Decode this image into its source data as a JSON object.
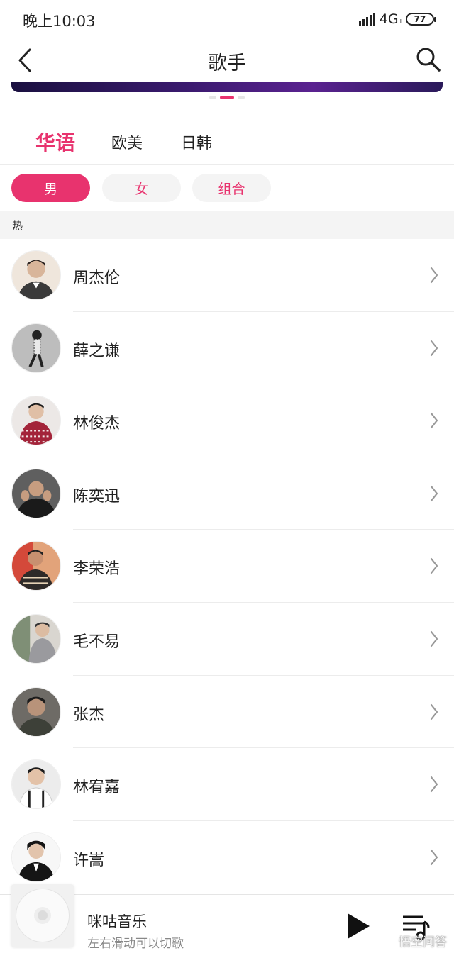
{
  "status_bar": {
    "time": "晚上10:03",
    "network": "4G",
    "battery": "77"
  },
  "header": {
    "title": "歌手",
    "back_icon": "chevron-left-icon",
    "search_icon": "search-icon"
  },
  "region_tabs": [
    {
      "label": "华语",
      "active": true
    },
    {
      "label": "欧美",
      "active": false
    },
    {
      "label": "日韩",
      "active": false
    }
  ],
  "gender_filters": [
    {
      "label": "男",
      "active": true
    },
    {
      "label": "女",
      "active": false
    },
    {
      "label": "组合",
      "active": false
    }
  ],
  "section": {
    "label": "热"
  },
  "artists": [
    {
      "name": "周杰伦"
    },
    {
      "name": "薛之谦"
    },
    {
      "name": "林俊杰"
    },
    {
      "name": "陈奕迅"
    },
    {
      "name": "李荣浩"
    },
    {
      "name": "毛不易"
    },
    {
      "name": "张杰"
    },
    {
      "name": "林宥嘉"
    },
    {
      "name": "许嵩"
    }
  ],
  "player": {
    "title": "咪咕音乐",
    "subtitle": "左右滑动可以切歌",
    "play_icon": "play-icon",
    "playlist_icon": "playlist-icon"
  },
  "watermark": "悟空问答",
  "colors": {
    "accent": "#e8336e",
    "pill_bg": "#f4f4f4",
    "section_bg": "#f4f4f4",
    "divider": "#ececec"
  }
}
